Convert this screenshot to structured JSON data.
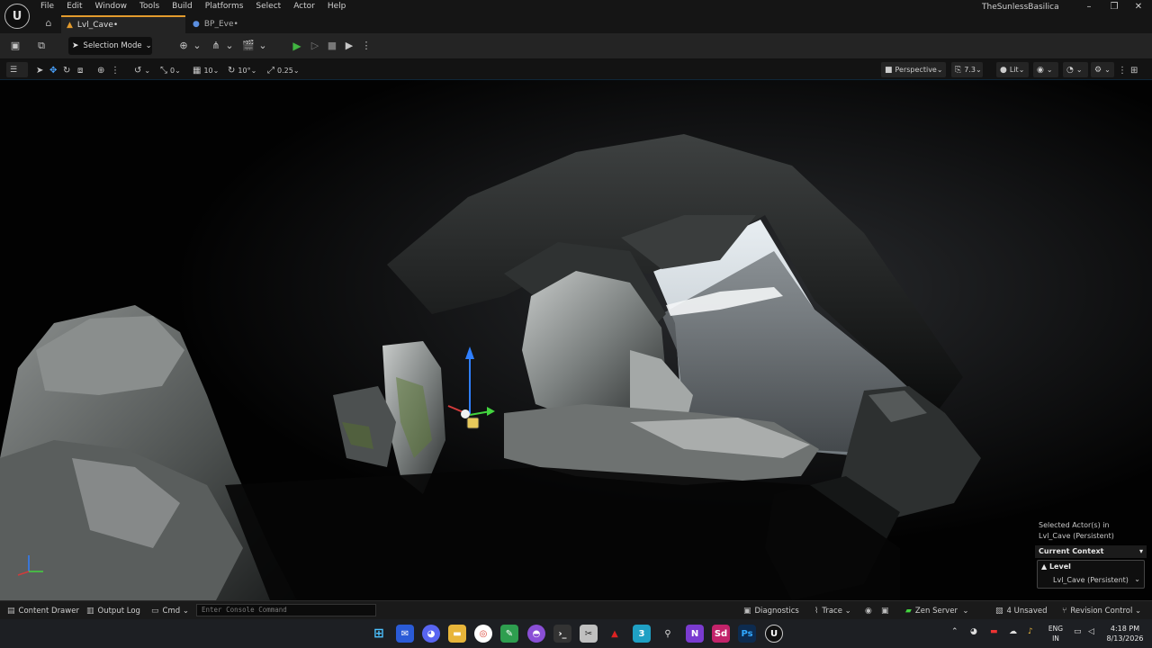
{
  "menu": {
    "logo_label": "U",
    "items": [
      "File",
      "Edit",
      "Window",
      "Tools",
      "Build",
      "Platforms",
      "Select",
      "Actor",
      "Help"
    ]
  },
  "project_title": "TheSunlessBasilica",
  "window_controls": {
    "minimize": "–",
    "restore": "❐",
    "close": "✕"
  },
  "tabs": [
    {
      "label": "Lvl_Cave•",
      "icon": "level-icon",
      "active": true
    },
    {
      "label": "BP_Eve•",
      "icon": "blueprint-actor-icon",
      "active": false
    }
  ],
  "toolbar": {
    "selection_mode": "Selection Mode",
    "save_icon": "save-icon",
    "content_icon": "source-control-icon"
  },
  "viewport_toolbar": {
    "translate_snap": "0",
    "grid_snap": "10",
    "rotation_snap": "10°",
    "scale_snap": "0.25",
    "view_mode": "Perspective",
    "camera_speed": "7.3",
    "lighting": "Lit"
  },
  "context_panel": {
    "selected_line1": "Selected Actor(s) in",
    "selected_line2": "Lvl_Cave (Persistent)",
    "current_context": "Current Context",
    "level_label": "Level",
    "level_value": "Lvl_Cave (Persistent)"
  },
  "statusbar": {
    "content_drawer": "Content Drawer",
    "output_log": "Output Log",
    "cmd": "Cmd",
    "console_placeholder": "Enter Console Command",
    "diagnostics": "Diagnostics",
    "trace": "Trace",
    "zen_server": "Zen Server",
    "unsaved": "4 Unsaved",
    "revision_control": "Revision Control"
  },
  "taskbar": {
    "lang_line1": "ENG",
    "lang_line2": "IN",
    "time": "4:18 PM",
    "date": "8/13/2026"
  },
  "colors": {
    "accent_orange": "#e39b2d",
    "play_green": "#41b441",
    "gizmo_blue": "#2f7fff",
    "gizmo_green": "#43d43f",
    "gizmo_red": "#d23b3b"
  }
}
